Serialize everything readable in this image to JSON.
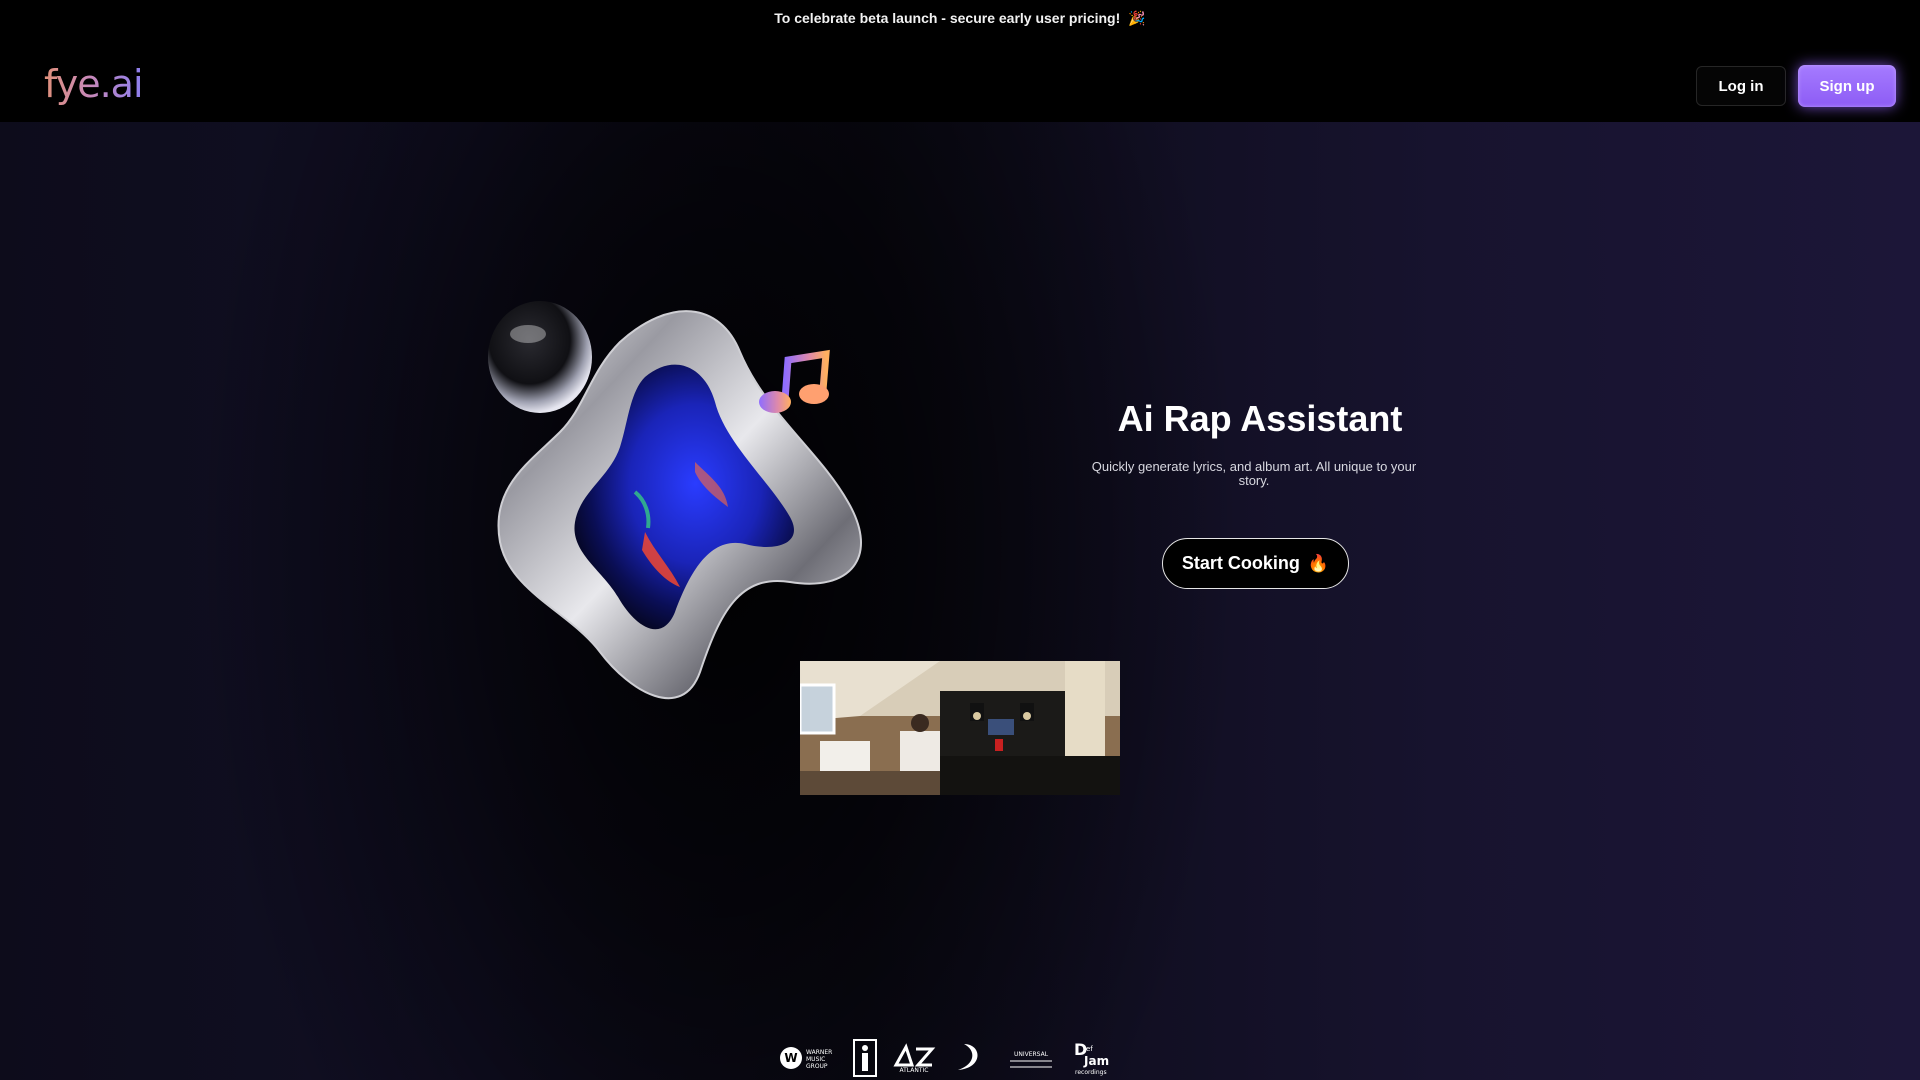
{
  "banner": {
    "text": "To celebrate beta launch - secure early user pricing!",
    "emoji": "🎉"
  },
  "header": {
    "logo": "fye.ai",
    "login_label": "Log in",
    "signup_label": "Sign up"
  },
  "hero": {
    "title": "Ai Rap Assistant",
    "subtitle": "Quickly generate lyrics, and album art. All unique to your story.",
    "cta_label": "Start Cooking",
    "cta_icon": "fire-emoji",
    "art_icons": [
      "chrome-blob",
      "glass-bubble",
      "music-note-icon"
    ]
  },
  "video": {
    "description_icon": "studio-video-thumbnail"
  },
  "record_labels": {
    "warner": "WARNER MUSIC GROUP",
    "atlantic": "ATLANTIC",
    "dj": "Def Jam recordings"
  },
  "colors": {
    "accent": "#9b6bff",
    "background": "#000000",
    "logo_gradient_start": "#e0907a",
    "logo_gradient_end": "#8d7ff0"
  }
}
